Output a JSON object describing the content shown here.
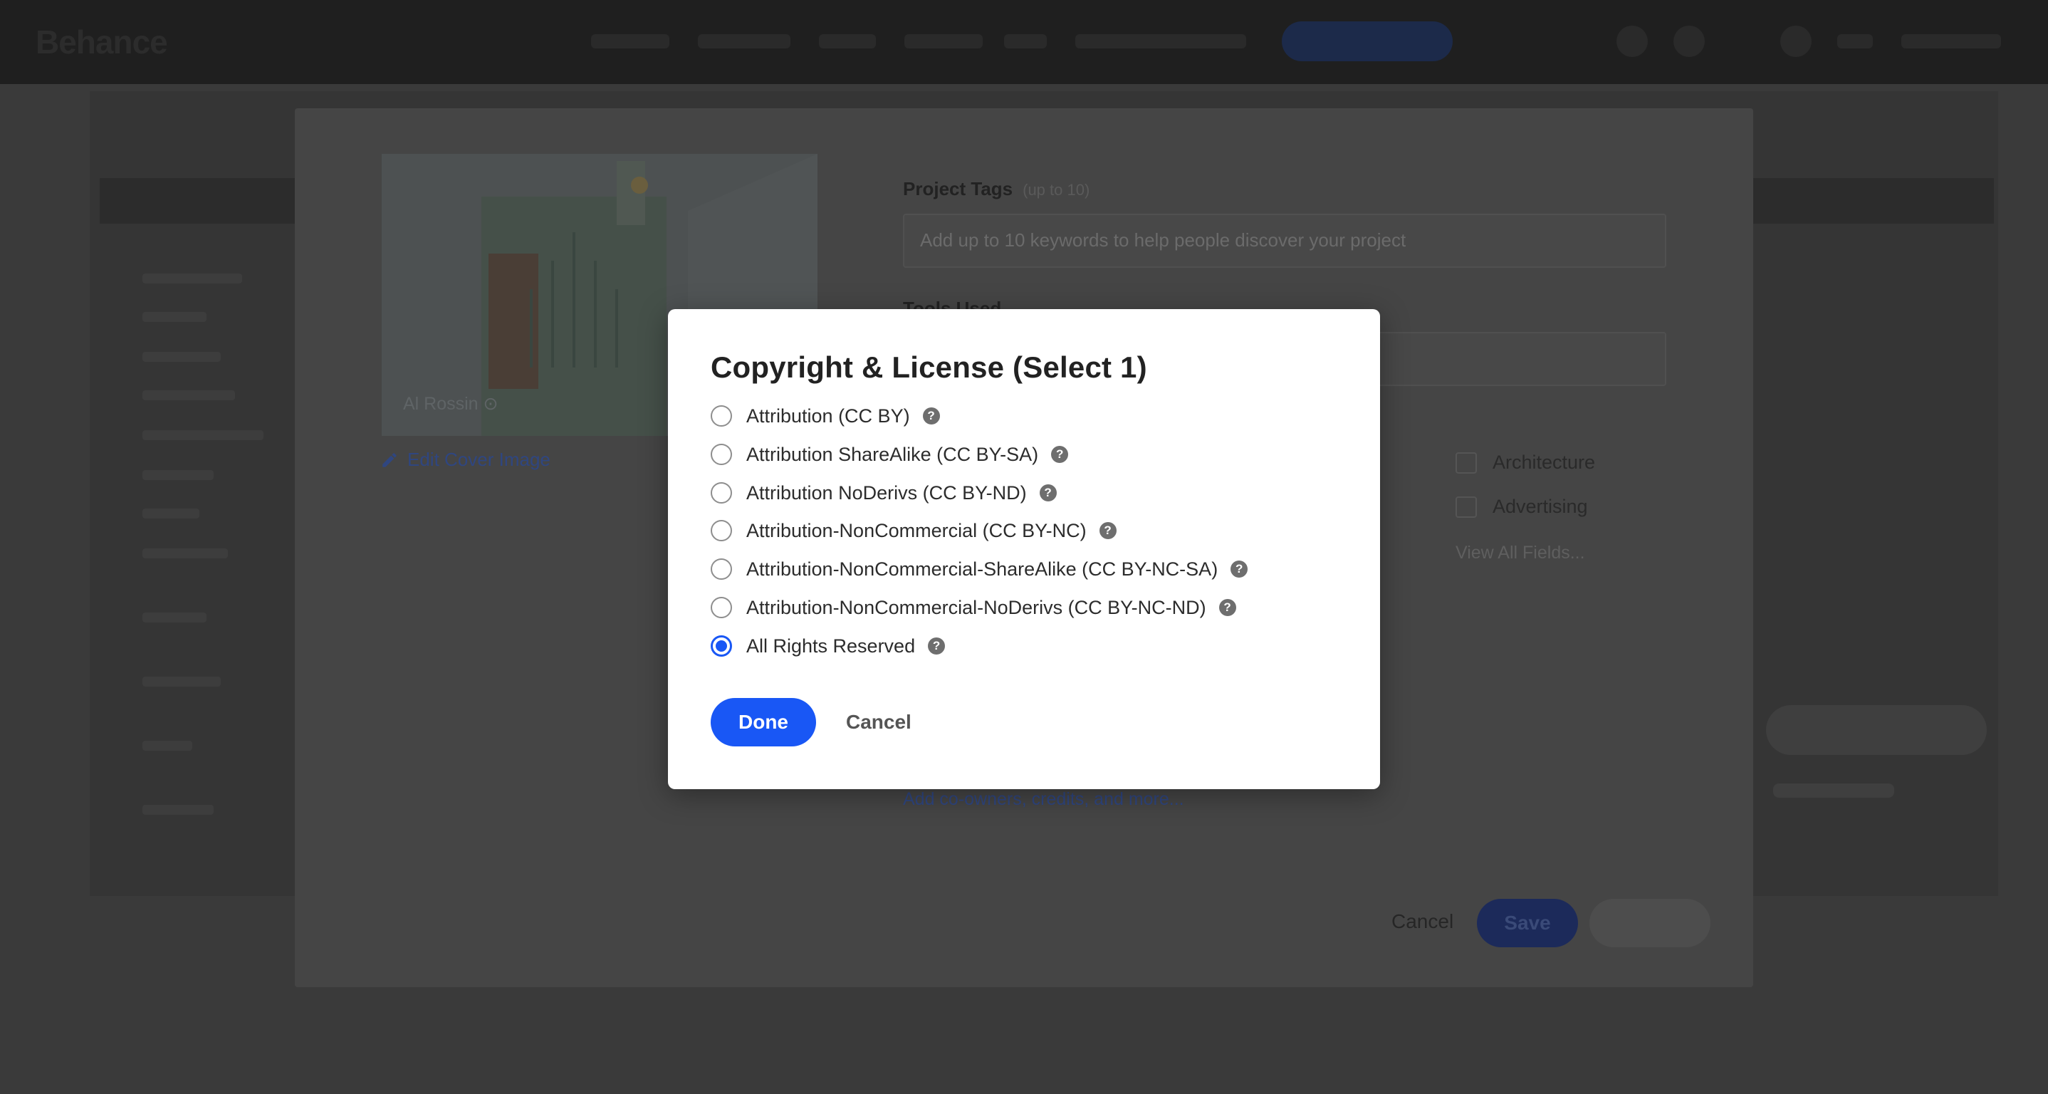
{
  "app": {
    "logo": "Behance"
  },
  "editor": {
    "cover_author": "Al Rossin ⊙",
    "edit_cover_label": "Edit Cover Image",
    "project_tags_label": "Project Tags",
    "project_tags_hint": "(up to 10)",
    "project_tags_placeholder": "Add up to 10 keywords to help people discover your project",
    "tools_used_label": "Tools Used",
    "fields": [
      {
        "label": "Architecture",
        "checked": false
      },
      {
        "label": "Advertising",
        "checked": false
      }
    ],
    "view_all_fields": "View All Fields...",
    "add_credits": "Add co-owners, credits, and more...",
    "cancel_label": "Cancel",
    "save_label": "Save"
  },
  "dialog": {
    "title": "Copyright & License (Select 1)",
    "options": [
      {
        "label": "Attribution (CC BY)",
        "selected": false
      },
      {
        "label": "Attribution ShareAlike (CC BY-SA)",
        "selected": false
      },
      {
        "label": "Attribution NoDerivs (CC BY-ND)",
        "selected": false
      },
      {
        "label": "Attribution-NonCommercial (CC BY-NC)",
        "selected": false
      },
      {
        "label": "Attribution-NonCommercial-ShareAlike (CC BY-NC-SA)",
        "selected": false
      },
      {
        "label": "Attribution-NonCommercial-NoDerivs (CC BY-NC-ND)",
        "selected": false
      },
      {
        "label": "All Rights Reserved",
        "selected": true
      }
    ],
    "help_glyph": "?",
    "done_label": "Done",
    "cancel_label": "Cancel"
  },
  "colors": {
    "accent": "#1957f5",
    "overlay": "#3a3a3a",
    "dialog_bg": "#ffffff",
    "text": "#2c2c2c"
  }
}
